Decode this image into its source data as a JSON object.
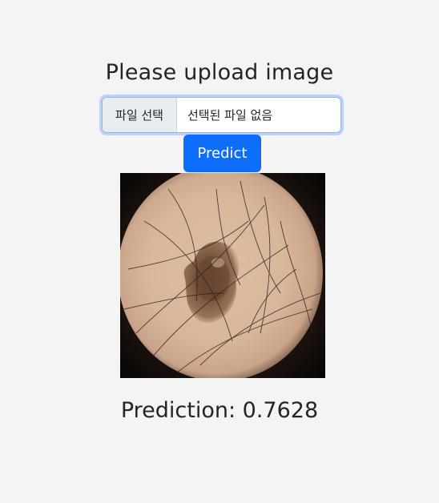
{
  "heading": "Please upload image",
  "file_input": {
    "button_label": "파일 선택",
    "status_text": "선택된 파일 없음"
  },
  "predict_button": "Predict",
  "image": {
    "subject": "dermoscopy skin lesion"
  },
  "prediction_label": "Prediction: 0.7628",
  "colors": {
    "background": "#f4f4f4",
    "primary": "#0d6efd",
    "focus_border": "#86b7fe"
  }
}
